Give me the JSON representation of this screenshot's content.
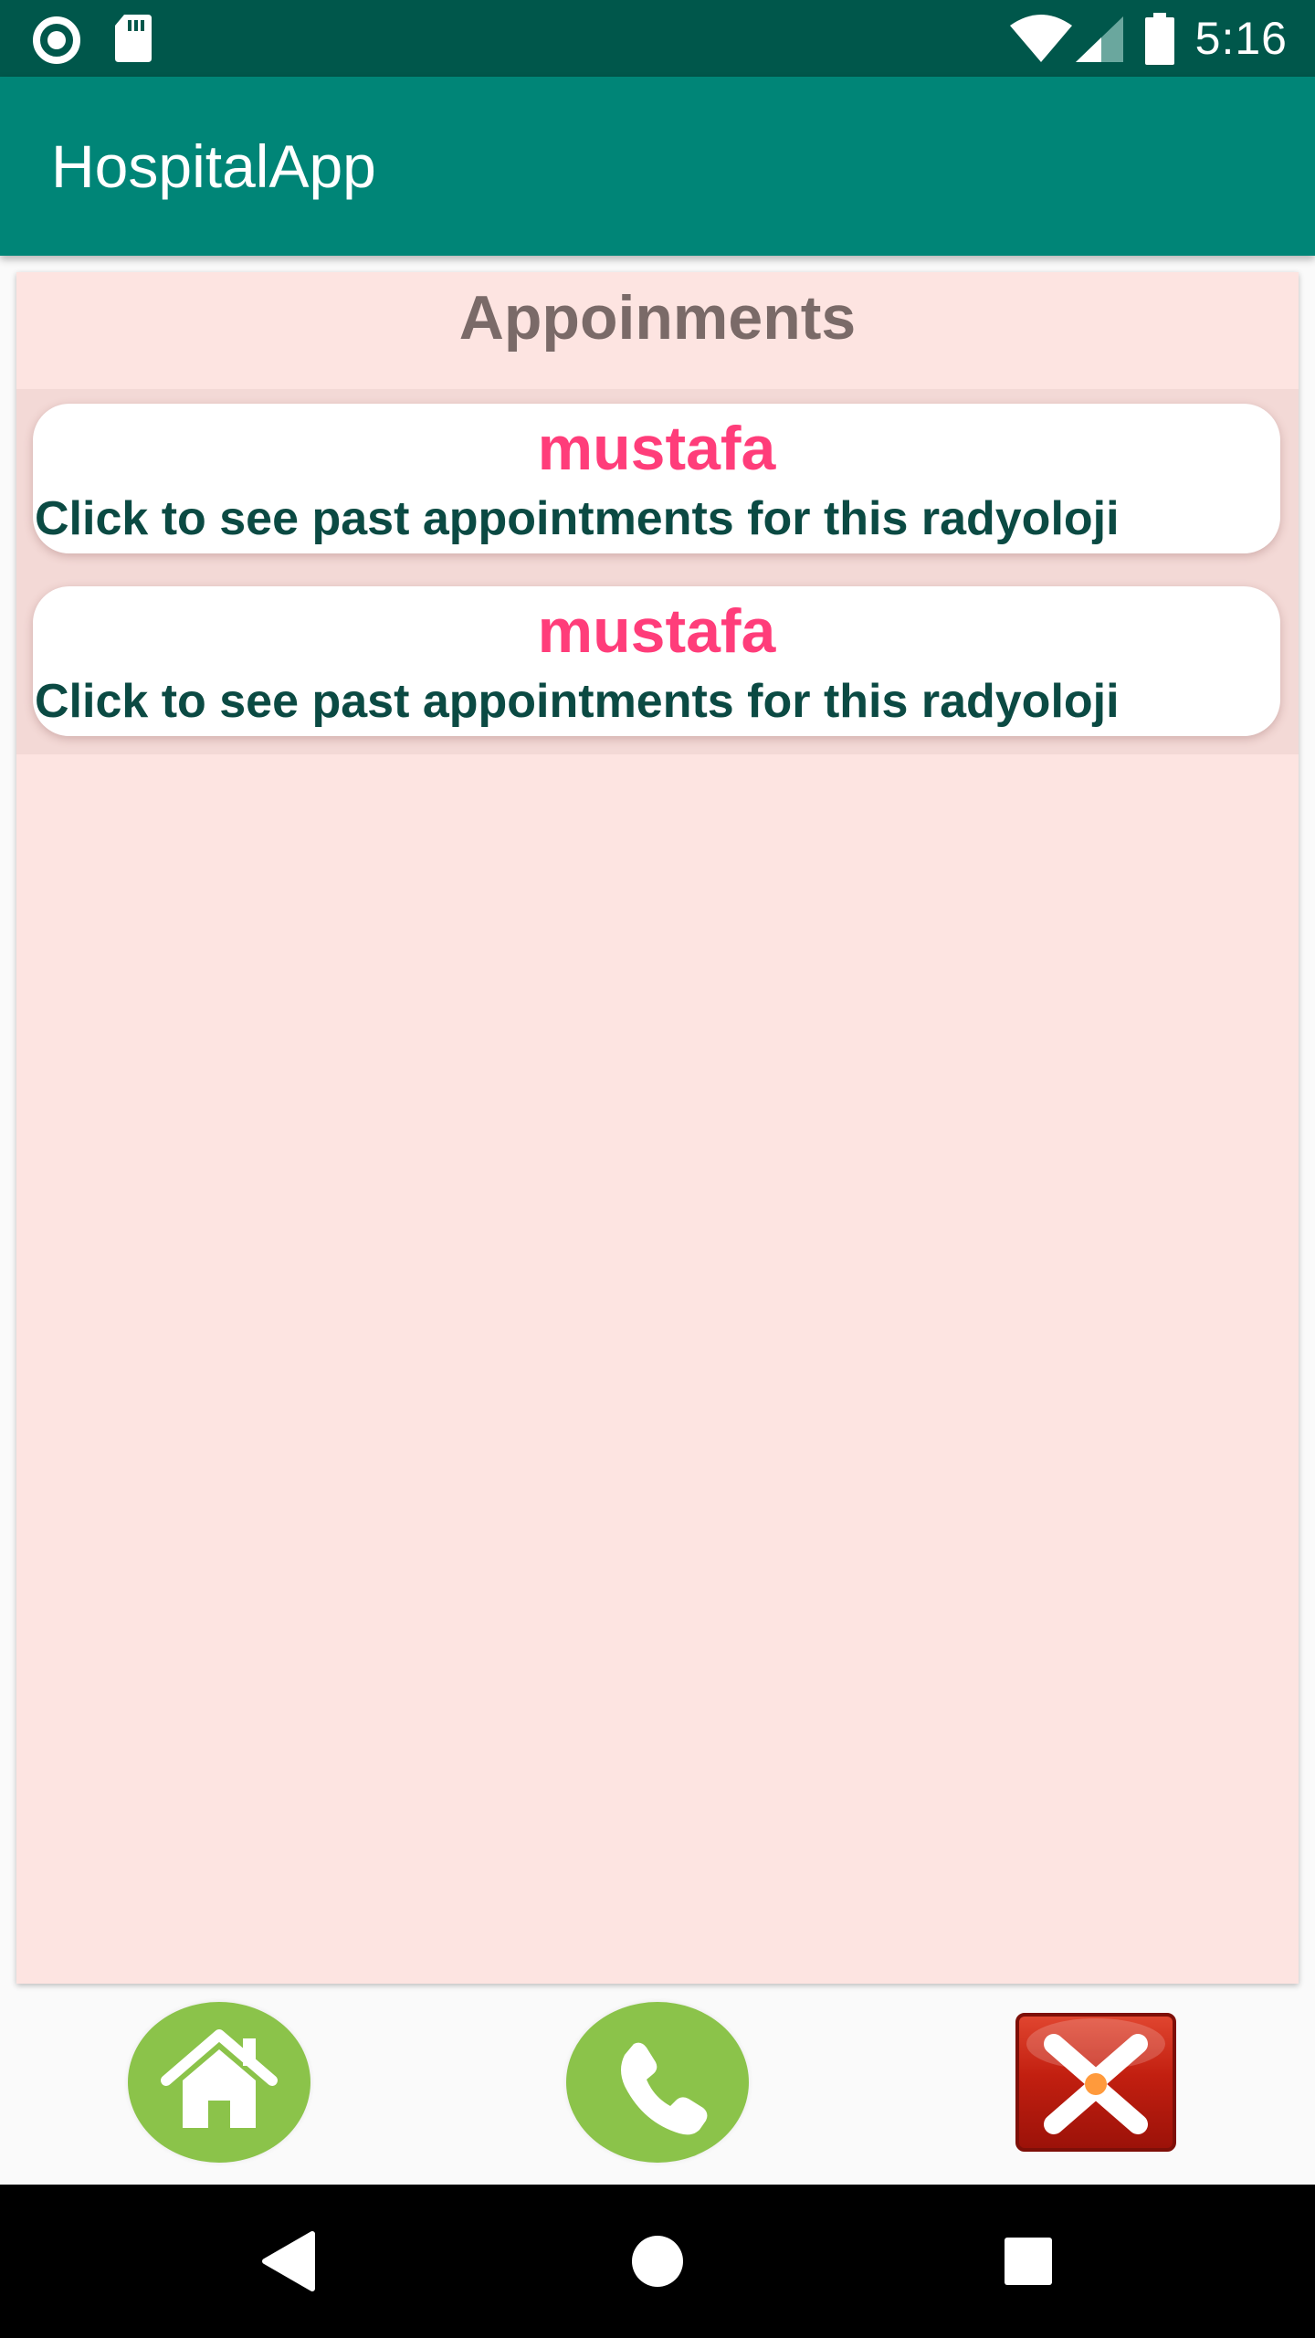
{
  "status_bar": {
    "time": "5:16",
    "icons": [
      "record-icon",
      "sd-card-icon",
      "wifi-icon",
      "cell-signal-icon",
      "battery-icon"
    ]
  },
  "app_bar": {
    "title": "HospitalApp"
  },
  "panel": {
    "heading": "Appoinments",
    "items": [
      {
        "name": "mustafa",
        "subtitle": "Click to see past appointments for this radyoloji"
      },
      {
        "name": "mustafa",
        "subtitle": "Click to see past appointments for this radyoloji"
      }
    ]
  },
  "bottom_buttons": [
    "home-icon",
    "phone-icon",
    "close-icon"
  ],
  "nav_bar": [
    "back-icon",
    "home-circle-icon",
    "recents-icon"
  ],
  "colors": {
    "status_bar": "#00574b",
    "app_bar": "#008577",
    "panel_bg": "#fde4e1",
    "name_text": "#ff3d7a",
    "subtitle_text": "#0b4a43",
    "heading_text": "#7a6a68",
    "button_green": "#8bc34a",
    "close_red": "#c21f10"
  }
}
